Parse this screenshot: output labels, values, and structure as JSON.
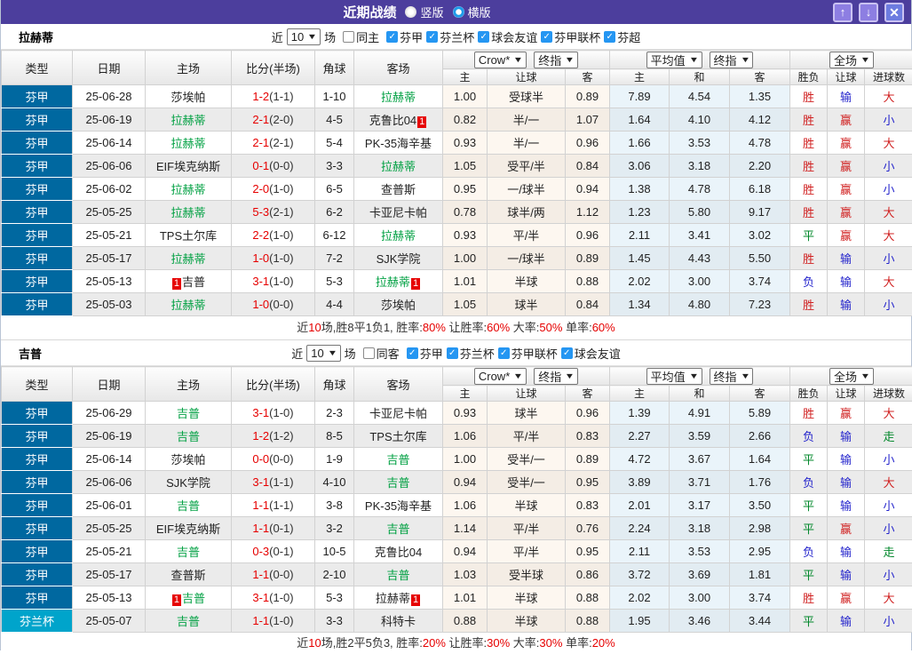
{
  "title_bar": {
    "title": "近期战绩",
    "radios": [
      {
        "label": "竖版",
        "selected": false
      },
      {
        "label": "横版",
        "selected": true
      }
    ],
    "up_label": "↑",
    "down_label": "↓",
    "close_label": "✕"
  },
  "columns": {
    "left": [
      "类型",
      "日期",
      "主场",
      "比分(半场)",
      "角球",
      "客场"
    ],
    "crow_group": {
      "select1": "Crow*",
      "select2": "终指",
      "subs": [
        "主",
        "让球",
        "客"
      ]
    },
    "avg_group": {
      "select1": "平均值",
      "select2": "终指",
      "subs": [
        "主",
        "和",
        "客"
      ]
    },
    "full_group": {
      "select": "全场",
      "subs": [
        "胜负",
        "让球",
        "进球数"
      ]
    }
  },
  "sections": [
    {
      "team": "拉赫蒂",
      "filter": {
        "prefix": "近",
        "count": "10",
        "suffix": "场",
        "same_label": "同主",
        "same_checked": false,
        "leagues": [
          {
            "label": "芬甲",
            "checked": true
          },
          {
            "label": "芬兰杯",
            "checked": true
          },
          {
            "label": "球会友谊",
            "checked": true
          },
          {
            "label": "芬甲联杯",
            "checked": true
          },
          {
            "label": "芬超",
            "checked": true
          }
        ]
      },
      "rows": [
        {
          "type": "芬甲",
          "date": "25-06-28",
          "home": "莎埃帕",
          "home_hl": false,
          "home_badge": "",
          "score": "1-2",
          "half": "(1-1)",
          "corner": "1-10",
          "away": "拉赫蒂",
          "away_hl": true,
          "away_badge": "",
          "crow_home": "1.00",
          "crow_hcap": "受球半",
          "crow_away": "0.89",
          "avg_home": "7.89",
          "avg_draw": "4.54",
          "avg_away": "1.35",
          "res_outcome": "胜",
          "res_hcap": "输",
          "res_goal": "大"
        },
        {
          "type": "芬甲",
          "date": "25-06-19",
          "home": "拉赫蒂",
          "home_hl": true,
          "home_badge": "",
          "score": "2-1",
          "half": "(2-0)",
          "corner": "4-5",
          "away": "克鲁比04",
          "away_hl": false,
          "away_badge": "1",
          "crow_home": "0.82",
          "crow_hcap": "半/一",
          "crow_away": "1.07",
          "avg_home": "1.64",
          "avg_draw": "4.10",
          "avg_away": "4.12",
          "res_outcome": "胜",
          "res_hcap": "赢",
          "res_goal": "小"
        },
        {
          "type": "芬甲",
          "date": "25-06-14",
          "home": "拉赫蒂",
          "home_hl": true,
          "home_badge": "",
          "score": "2-1",
          "half": "(2-1)",
          "corner": "5-4",
          "away": "PK-35海辛基",
          "away_hl": false,
          "away_badge": "",
          "crow_home": "0.93",
          "crow_hcap": "半/一",
          "crow_away": "0.96",
          "avg_home": "1.66",
          "avg_draw": "3.53",
          "avg_away": "4.78",
          "res_outcome": "胜",
          "res_hcap": "赢",
          "res_goal": "大"
        },
        {
          "type": "芬甲",
          "date": "25-06-06",
          "home": "EIF埃克纳斯",
          "home_hl": false,
          "home_badge": "",
          "score": "0-1",
          "half": "(0-0)",
          "corner": "3-3",
          "away": "拉赫蒂",
          "away_hl": true,
          "away_badge": "",
          "crow_home": "1.05",
          "crow_hcap": "受平/半",
          "crow_away": "0.84",
          "avg_home": "3.06",
          "avg_draw": "3.18",
          "avg_away": "2.20",
          "res_outcome": "胜",
          "res_hcap": "赢",
          "res_goal": "小"
        },
        {
          "type": "芬甲",
          "date": "25-06-02",
          "home": "拉赫蒂",
          "home_hl": true,
          "home_badge": "",
          "score": "2-0",
          "half": "(1-0)",
          "corner": "6-5",
          "away": "查普斯",
          "away_hl": false,
          "away_badge": "",
          "crow_home": "0.95",
          "crow_hcap": "一/球半",
          "crow_away": "0.94",
          "avg_home": "1.38",
          "avg_draw": "4.78",
          "avg_away": "6.18",
          "res_outcome": "胜",
          "res_hcap": "赢",
          "res_goal": "小"
        },
        {
          "type": "芬甲",
          "date": "25-05-25",
          "home": "拉赫蒂",
          "home_hl": true,
          "home_badge": "",
          "score": "5-3",
          "half": "(2-1)",
          "corner": "6-2",
          "away": "卡亚尼卡帕",
          "away_hl": false,
          "away_badge": "",
          "crow_home": "0.78",
          "crow_hcap": "球半/两",
          "crow_away": "1.12",
          "avg_home": "1.23",
          "avg_draw": "5.80",
          "avg_away": "9.17",
          "res_outcome": "胜",
          "res_hcap": "赢",
          "res_goal": "大"
        },
        {
          "type": "芬甲",
          "date": "25-05-21",
          "home": "TPS土尔库",
          "home_hl": false,
          "home_badge": "",
          "score": "2-2",
          "half": "(1-0)",
          "corner": "6-12",
          "away": "拉赫蒂",
          "away_hl": true,
          "away_badge": "",
          "crow_home": "0.93",
          "crow_hcap": "平/半",
          "crow_away": "0.96",
          "avg_home": "2.11",
          "avg_draw": "3.41",
          "avg_away": "3.02",
          "res_outcome": "平",
          "res_hcap": "赢",
          "res_goal": "大"
        },
        {
          "type": "芬甲",
          "date": "25-05-17",
          "home": "拉赫蒂",
          "home_hl": true,
          "home_badge": "",
          "score": "1-0",
          "half": "(1-0)",
          "corner": "7-2",
          "away": "SJK学院",
          "away_hl": false,
          "away_badge": "",
          "crow_home": "1.00",
          "crow_hcap": "一/球半",
          "crow_away": "0.89",
          "avg_home": "1.45",
          "avg_draw": "4.43",
          "avg_away": "5.50",
          "res_outcome": "胜",
          "res_hcap": "输",
          "res_goal": "小"
        },
        {
          "type": "芬甲",
          "date": "25-05-13",
          "home": "吉普",
          "home_hl": false,
          "home_badge": "1",
          "score": "3-1",
          "half": "(1-0)",
          "corner": "5-3",
          "away": "拉赫蒂",
          "away_hl": true,
          "away_badge": "1",
          "crow_home": "1.01",
          "crow_hcap": "半球",
          "crow_away": "0.88",
          "avg_home": "2.02",
          "avg_draw": "3.00",
          "avg_away": "3.74",
          "res_outcome": "负",
          "res_hcap": "输",
          "res_goal": "大"
        },
        {
          "type": "芬甲",
          "date": "25-05-03",
          "home": "拉赫蒂",
          "home_hl": true,
          "home_badge": "",
          "score": "1-0",
          "half": "(0-0)",
          "corner": "4-4",
          "away": "莎埃帕",
          "away_hl": false,
          "away_badge": "",
          "crow_home": "1.05",
          "crow_hcap": "球半",
          "crow_away": "0.84",
          "avg_home": "1.34",
          "avg_draw": "4.80",
          "avg_away": "7.23",
          "res_outcome": "胜",
          "res_hcap": "输",
          "res_goal": "小"
        }
      ],
      "summary": [
        [
          "近",
          0
        ],
        [
          "10",
          1
        ],
        [
          "场,胜8平1负1, 胜率:",
          0
        ],
        [
          "80%",
          1
        ],
        [
          " 让胜率:",
          0
        ],
        [
          "60%",
          1
        ],
        [
          " 大率:",
          0
        ],
        [
          "50%",
          1
        ],
        [
          " 单率:",
          0
        ],
        [
          "60%",
          1
        ]
      ]
    },
    {
      "team": "吉普",
      "filter": {
        "prefix": "近",
        "count": "10",
        "suffix": "场",
        "same_label": "同客",
        "same_checked": false,
        "leagues": [
          {
            "label": "芬甲",
            "checked": true
          },
          {
            "label": "芬兰杯",
            "checked": true
          },
          {
            "label": "芬甲联杯",
            "checked": true
          },
          {
            "label": "球会友谊",
            "checked": true
          }
        ]
      },
      "rows": [
        {
          "type": "芬甲",
          "date": "25-06-29",
          "home": "吉普",
          "home_hl": true,
          "home_badge": "",
          "score": "3-1",
          "half": "(1-0)",
          "corner": "2-3",
          "away": "卡亚尼卡帕",
          "away_hl": false,
          "away_badge": "",
          "crow_home": "0.93",
          "crow_hcap": "球半",
          "crow_away": "0.96",
          "avg_home": "1.39",
          "avg_draw": "4.91",
          "avg_away": "5.89",
          "res_outcome": "胜",
          "res_hcap": "赢",
          "res_goal": "大"
        },
        {
          "type": "芬甲",
          "date": "25-06-19",
          "home": "吉普",
          "home_hl": true,
          "home_badge": "",
          "score": "1-2",
          "half": "(1-2)",
          "corner": "8-5",
          "away": "TPS土尔库",
          "away_hl": false,
          "away_badge": "",
          "crow_home": "1.06",
          "crow_hcap": "平/半",
          "crow_away": "0.83",
          "avg_home": "2.27",
          "avg_draw": "3.59",
          "avg_away": "2.66",
          "res_outcome": "负",
          "res_hcap": "输",
          "res_goal": "走"
        },
        {
          "type": "芬甲",
          "date": "25-06-14",
          "home": "莎埃帕",
          "home_hl": false,
          "home_badge": "",
          "score": "0-0",
          "half": "(0-0)",
          "corner": "1-9",
          "away": "吉普",
          "away_hl": true,
          "away_badge": "",
          "crow_home": "1.00",
          "crow_hcap": "受半/一",
          "crow_away": "0.89",
          "avg_home": "4.72",
          "avg_draw": "3.67",
          "avg_away": "1.64",
          "res_outcome": "平",
          "res_hcap": "输",
          "res_goal": "小"
        },
        {
          "type": "芬甲",
          "date": "25-06-06",
          "home": "SJK学院",
          "home_hl": false,
          "home_badge": "",
          "score": "3-1",
          "half": "(1-1)",
          "corner": "4-10",
          "away": "吉普",
          "away_hl": true,
          "away_badge": "",
          "crow_home": "0.94",
          "crow_hcap": "受半/一",
          "crow_away": "0.95",
          "avg_home": "3.89",
          "avg_draw": "3.71",
          "avg_away": "1.76",
          "res_outcome": "负",
          "res_hcap": "输",
          "res_goal": "大"
        },
        {
          "type": "芬甲",
          "date": "25-06-01",
          "home": "吉普",
          "home_hl": true,
          "home_badge": "",
          "score": "1-1",
          "half": "(1-1)",
          "corner": "3-8",
          "away": "PK-35海辛基",
          "away_hl": false,
          "away_badge": "",
          "crow_home": "1.06",
          "crow_hcap": "半球",
          "crow_away": "0.83",
          "avg_home": "2.01",
          "avg_draw": "3.17",
          "avg_away": "3.50",
          "res_outcome": "平",
          "res_hcap": "输",
          "res_goal": "小"
        },
        {
          "type": "芬甲",
          "date": "25-05-25",
          "home": "EIF埃克纳斯",
          "home_hl": false,
          "home_badge": "",
          "score": "1-1",
          "half": "(0-1)",
          "corner": "3-2",
          "away": "吉普",
          "away_hl": true,
          "away_badge": "",
          "crow_home": "1.14",
          "crow_hcap": "平/半",
          "crow_away": "0.76",
          "avg_home": "2.24",
          "avg_draw": "3.18",
          "avg_away": "2.98",
          "res_outcome": "平",
          "res_hcap": "赢",
          "res_goal": "小"
        },
        {
          "type": "芬甲",
          "date": "25-05-21",
          "home": "吉普",
          "home_hl": true,
          "home_badge": "",
          "score": "0-3",
          "half": "(0-1)",
          "corner": "10-5",
          "away": "克鲁比04",
          "away_hl": false,
          "away_badge": "",
          "crow_home": "0.94",
          "crow_hcap": "平/半",
          "crow_away": "0.95",
          "avg_home": "2.11",
          "avg_draw": "3.53",
          "avg_away": "2.95",
          "res_outcome": "负",
          "res_hcap": "输",
          "res_goal": "走"
        },
        {
          "type": "芬甲",
          "date": "25-05-17",
          "home": "查普斯",
          "home_hl": false,
          "home_badge": "",
          "score": "1-1",
          "half": "(0-0)",
          "corner": "2-10",
          "away": "吉普",
          "away_hl": true,
          "away_badge": "",
          "crow_home": "1.03",
          "crow_hcap": "受半球",
          "crow_away": "0.86",
          "avg_home": "3.72",
          "avg_draw": "3.69",
          "avg_away": "1.81",
          "res_outcome": "平",
          "res_hcap": "输",
          "res_goal": "小"
        },
        {
          "type": "芬甲",
          "date": "25-05-13",
          "home": "吉普",
          "home_hl": true,
          "home_badge": "1",
          "score": "3-1",
          "half": "(1-0)",
          "corner": "5-3",
          "away": "拉赫蒂",
          "away_hl": false,
          "away_badge": "1",
          "crow_home": "1.01",
          "crow_hcap": "半球",
          "crow_away": "0.88",
          "avg_home": "2.02",
          "avg_draw": "3.00",
          "avg_away": "3.74",
          "res_outcome": "胜",
          "res_hcap": "赢",
          "res_goal": "大"
        },
        {
          "type": "芬兰杯",
          "date": "25-05-07",
          "home": "吉普",
          "home_hl": true,
          "home_badge": "",
          "score": "1-1",
          "half": "(1-0)",
          "corner": "3-3",
          "away": "科特卡",
          "away_hl": false,
          "away_badge": "",
          "crow_home": "0.88",
          "crow_hcap": "半球",
          "crow_away": "0.88",
          "avg_home": "1.95",
          "avg_draw": "3.46",
          "avg_away": "3.44",
          "res_outcome": "平",
          "res_hcap": "输",
          "res_goal": "小"
        }
      ],
      "summary": [
        [
          "近",
          0
        ],
        [
          "10",
          1
        ],
        [
          "场,胜2平5负3, 胜率:",
          0
        ],
        [
          "20%",
          1
        ],
        [
          " 让胜率:",
          0
        ],
        [
          "30%",
          1
        ],
        [
          " 大率:",
          0
        ],
        [
          "30%",
          1
        ],
        [
          " 单率:",
          0
        ],
        [
          "20%",
          1
        ]
      ]
    }
  ]
}
